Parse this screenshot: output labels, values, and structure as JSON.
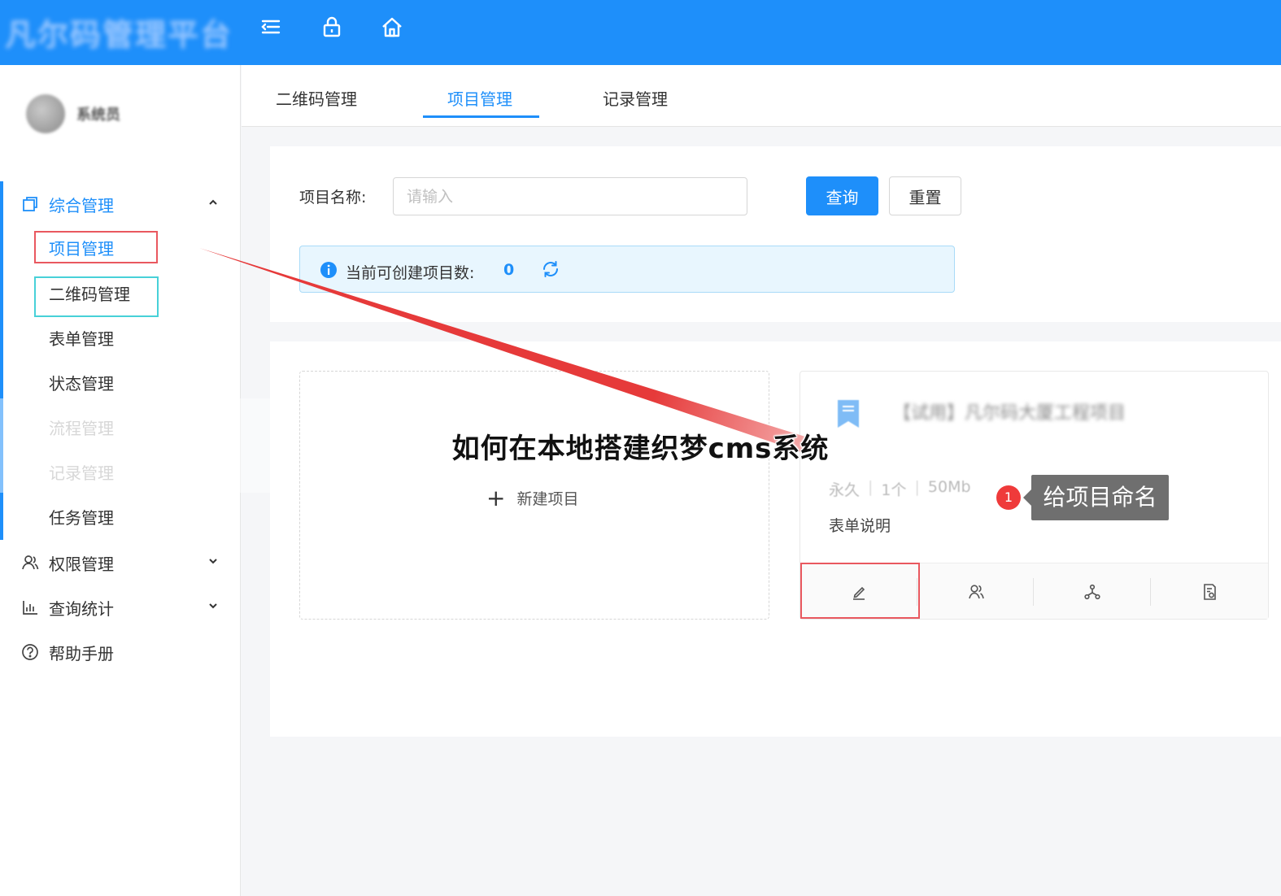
{
  "app": {
    "title": "凡尔码管理平台"
  },
  "user": {
    "name": "系统员"
  },
  "sidebar": {
    "groups": [
      {
        "label": "综合管理",
        "items": [
          "项目管理",
          "二维码管理",
          "表单管理",
          "状态管理",
          "流程管理",
          "记录管理",
          "任务管理"
        ]
      },
      {
        "label": "权限管理"
      },
      {
        "label": "查询统计"
      },
      {
        "label": "帮助手册"
      }
    ]
  },
  "tabs": [
    "二维码管理",
    "项目管理",
    "记录管理"
  ],
  "search": {
    "label": "项目名称:",
    "placeholder": "请输入",
    "query_label": "查询",
    "reset_label": "重置"
  },
  "info": {
    "text": "当前可创建项目数:",
    "count": "0"
  },
  "new_project_label": "新建项目",
  "project": {
    "title": "【试用】凡尔码大厦工程项目",
    "duration": "永久",
    "count": "1个",
    "size": "50Mb",
    "description": "表单说明"
  },
  "tooltip": {
    "number": "1",
    "text": "给项目命名"
  },
  "caption": "如何在本地搭建织梦cms系统",
  "colors": {
    "primary": "#1e8ffa",
    "highlight_red": "#e9585f",
    "highlight_teal": "#48d1d8",
    "badge": "#ef3a3a"
  }
}
